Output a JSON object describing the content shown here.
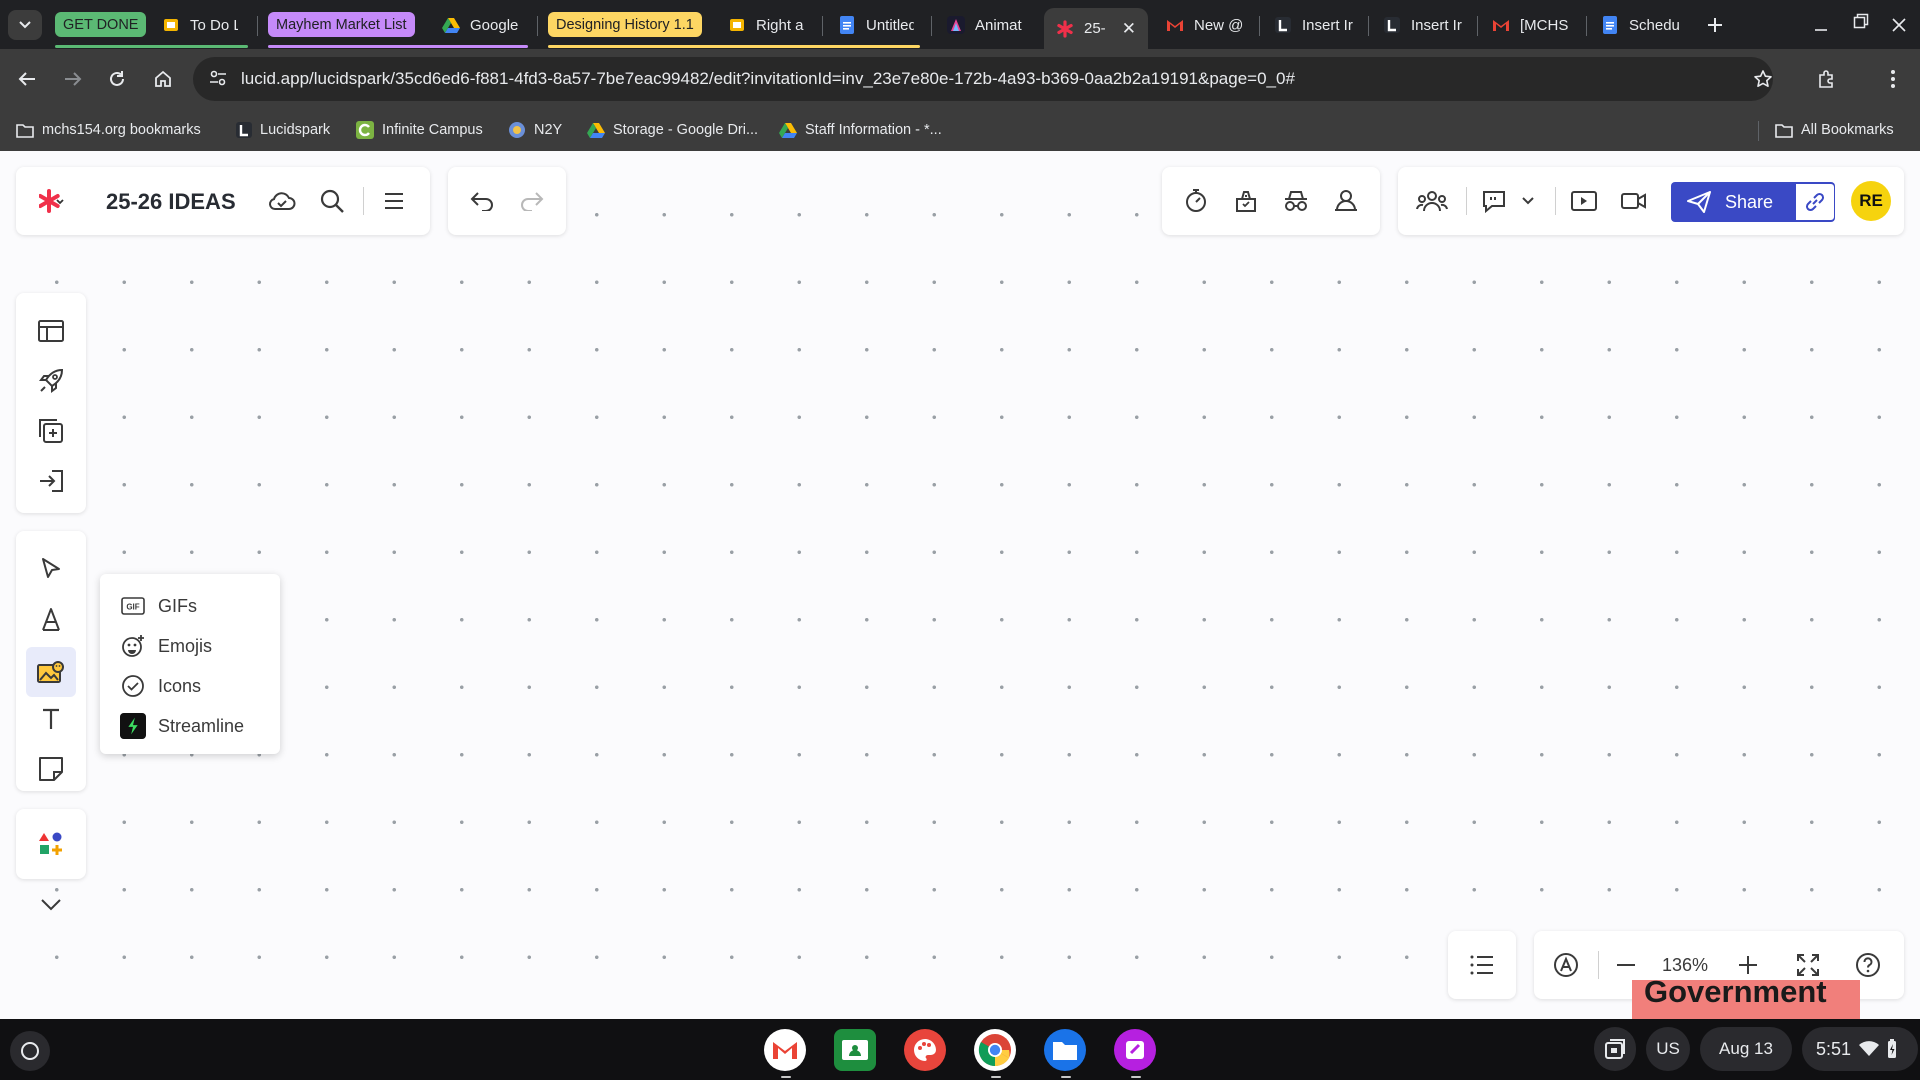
{
  "browser": {
    "tab_groups": [
      {
        "label": "GET DONE",
        "color": "#5bb974"
      },
      {
        "label": "Mayhem Market List",
        "color": "#c58af9"
      },
      {
        "label": "Designing History 1.1",
        "color": "#fdd663"
      }
    ],
    "tabs": [
      {
        "label": "To Do L",
        "icon": "slides-icon"
      },
      {
        "label": "Google",
        "icon": "drive-icon"
      },
      {
        "label": "Right ar",
        "icon": "slides-icon"
      },
      {
        "label": "Untitled",
        "icon": "docs-icon"
      },
      {
        "label": "Animat",
        "icon": "canva-icon"
      },
      {
        "label": "25-",
        "icon": "lucidspark-icon",
        "active": true
      },
      {
        "label": "New @",
        "icon": "gmail-icon"
      },
      {
        "label": "Insert Ir",
        "icon": "lucid-icon"
      },
      {
        "label": "Insert Ir",
        "icon": "lucid-icon"
      },
      {
        "label": "[MCHS",
        "icon": "gmail-icon"
      },
      {
        "label": "Schedu",
        "icon": "docs-icon"
      }
    ],
    "url": "lucid.app/lucidspark/35cd6ed6-f881-4fd3-8a57-7be7eac99482/edit?invitationId=inv_23e7e80e-172b-4a93-b369-0aa2b2a19191&page=0_0#",
    "bookmarks": [
      {
        "label": "mchs154.org bookmarks",
        "icon": "folder-icon"
      },
      {
        "label": "Lucidspark",
        "icon": "lucid-icon"
      },
      {
        "label": "Infinite Campus",
        "icon": "campus-icon"
      },
      {
        "label": "N2Y",
        "icon": "n2y-icon"
      },
      {
        "label": "Storage - Google Dri...",
        "icon": "drive-icon"
      },
      {
        "label": "Staff Information - *...",
        "icon": "drive-icon"
      }
    ],
    "all_bookmarks_label": "All Bookmarks"
  },
  "app": {
    "document_title": "25-26 IDEAS",
    "share_label": "Share",
    "avatar_initials": "RE",
    "avatar_color": "#f6d30e",
    "zoom_level": "136%",
    "canvas_text_fragment": "Government"
  },
  "insert_menu": {
    "items": [
      {
        "label": "GIFs",
        "icon": "gif-icon"
      },
      {
        "label": "Emojis",
        "icon": "emoji-icon"
      },
      {
        "label": "Icons",
        "icon": "check-circle-icon"
      },
      {
        "label": "Streamline",
        "icon": "streamline-icon"
      }
    ]
  },
  "system": {
    "input_method": "US",
    "date": "Aug 13",
    "time": "5:51"
  }
}
